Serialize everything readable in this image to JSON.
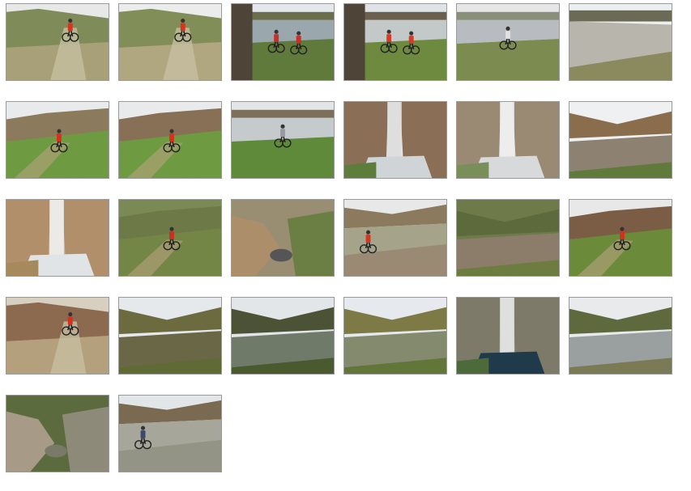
{
  "gallery": {
    "rows": [
      [
        {
          "scene": "trail-rider",
          "palette": {
            "sky": "#e8e8e8",
            "top": "#7f8c5a",
            "ground": "#a7a078",
            "accent": "#d9331f"
          }
        },
        {
          "scene": "trail-rider",
          "palette": {
            "sky": "#ececec",
            "top": "#818e58",
            "ground": "#b0a680",
            "accent": "#d9331f"
          }
        },
        {
          "scene": "river-riders-wall",
          "palette": {
            "sky": "#e4e8ee",
            "top": "#6a6e4a",
            "ground": "#5f7a3a",
            "accent": "#c6302a",
            "water": "#9aa7ad"
          }
        },
        {
          "scene": "river-riders-wall",
          "palette": {
            "sky": "#dfe3e7",
            "top": "#6b5f4d",
            "ground": "#6d8a3f",
            "accent": "#d63b28",
            "water": "#c3c8c8"
          }
        },
        {
          "scene": "river-rider",
          "palette": {
            "sky": "#e6e6e6",
            "top": "#8a8f7a",
            "ground": "#7c8c50",
            "accent": "#e0e0e0",
            "water": "#b8bcc0"
          }
        },
        {
          "scene": "river-bank",
          "palette": {
            "sky": "#eceff0",
            "top": "#6b6a55",
            "ground": "#8b8a5e",
            "accent": "#555",
            "water": "#b8b6ac"
          }
        }
      ],
      [
        {
          "scene": "hill-rider",
          "palette": {
            "sky": "#e8eaec",
            "top": "#8c7a5c",
            "ground": "#6e9a42",
            "accent": "#d8301f"
          }
        },
        {
          "scene": "hill-rider",
          "palette": {
            "sky": "#e8eaec",
            "top": "#877055",
            "ground": "#6e9a42",
            "accent": "#d8301f"
          }
        },
        {
          "scene": "river-rider",
          "palette": {
            "sky": "#e3e6e8",
            "top": "#7c705a",
            "ground": "#5e8a3a",
            "accent": "#9a9aa2",
            "water": "#c5cacd"
          }
        },
        {
          "scene": "cliff-fall",
          "palette": {
            "sky": "#e8e8e8",
            "top": "#8a6e55",
            "ground": "#5d7d3a",
            "accent": "#ddd",
            "water": "#cfd4d6"
          }
        },
        {
          "scene": "cliff-fall",
          "palette": {
            "sky": "#e0e0e0",
            "top": "#9a8a74",
            "ground": "#7a8e5a",
            "accent": "#eee",
            "water": "#d7d9da"
          }
        },
        {
          "scene": "canyon-river",
          "palette": {
            "sky": "#eef0f2",
            "top": "#8a6d4c",
            "ground": "#5f7a3a",
            "accent": "#888",
            "water": "#8d8272"
          }
        }
      ],
      [
        {
          "scene": "cliff-fall",
          "palette": {
            "sky": "#cdb89a",
            "top": "#b08f6a",
            "ground": "#a68a5e",
            "accent": "#f0f0f0",
            "water": "#e0e4e6"
          }
        },
        {
          "scene": "hill-rider",
          "palette": {
            "sky": "#7b8a55",
            "top": "#6d7a48",
            "ground": "#738645",
            "accent": "#c83021"
          }
        },
        {
          "scene": "rocks",
          "palette": {
            "sky": "#9a8e72",
            "top": "#ad8e6b",
            "ground": "#6b7f45",
            "accent": "#444",
            "water": "#555"
          }
        },
        {
          "scene": "rock-rider",
          "palette": {
            "sky": "#e8e8e8",
            "top": "#8b7a5e",
            "ground": "#9a8a74",
            "accent": "#cf3a25",
            "water": "#a5a48a"
          }
        },
        {
          "scene": "canyon-river",
          "palette": {
            "sky": "#6f7a4a",
            "top": "#5d6a3c",
            "ground": "#6c7d3f",
            "accent": "#666",
            "water": "#8b7d6a"
          }
        },
        {
          "scene": "hill-rider",
          "palette": {
            "sky": "#e8e8e8",
            "top": "#7b5c45",
            "ground": "#6b8a3a",
            "accent": "#d2311f"
          }
        }
      ],
      [
        {
          "scene": "trail-rider",
          "palette": {
            "sky": "#d7d0c0",
            "top": "#8b6a4f",
            "ground": "#b5a07e",
            "accent": "#d2311f"
          }
        },
        {
          "scene": "canyon-river",
          "palette": {
            "sky": "#e6e9ec",
            "top": "#6c6a3f",
            "ground": "#5f6a35",
            "accent": "#777",
            "water": "#6a6746"
          }
        },
        {
          "scene": "canyon-river",
          "palette": {
            "sky": "#e3e6e9",
            "top": "#4c5236",
            "ground": "#4a5a2e",
            "accent": "#666",
            "water": "#707a68"
          }
        },
        {
          "scene": "canyon-river",
          "palette": {
            "sky": "#e6eaee",
            "top": "#7d7a45",
            "ground": "#62763a",
            "accent": "#555",
            "water": "#848a6e"
          }
        },
        {
          "scene": "cliff-fall",
          "palette": {
            "sky": "#8a8a80",
            "top": "#7d7a6a",
            "ground": "#4d6a3a",
            "accent": "#e8e8e8",
            "water": "#1f3a4a"
          }
        },
        {
          "scene": "canyon-river",
          "palette": {
            "sky": "#e8eaec",
            "top": "#5e6a3e",
            "ground": "#7a7a55",
            "accent": "#2a3550",
            "water": "#9aa0a0"
          }
        }
      ],
      [
        {
          "scene": "rocks",
          "palette": {
            "sky": "#5b6b3d",
            "top": "#a79a86",
            "ground": "#8e8a7a",
            "accent": "#2a2a2a",
            "water": "#7a7a6a"
          }
        },
        {
          "scene": "rock-rider",
          "palette": {
            "sky": "#e3e6e8",
            "top": "#7b6a52",
            "ground": "#949486",
            "accent": "#3a4a6a",
            "water": "#a6a69a"
          }
        }
      ]
    ]
  }
}
